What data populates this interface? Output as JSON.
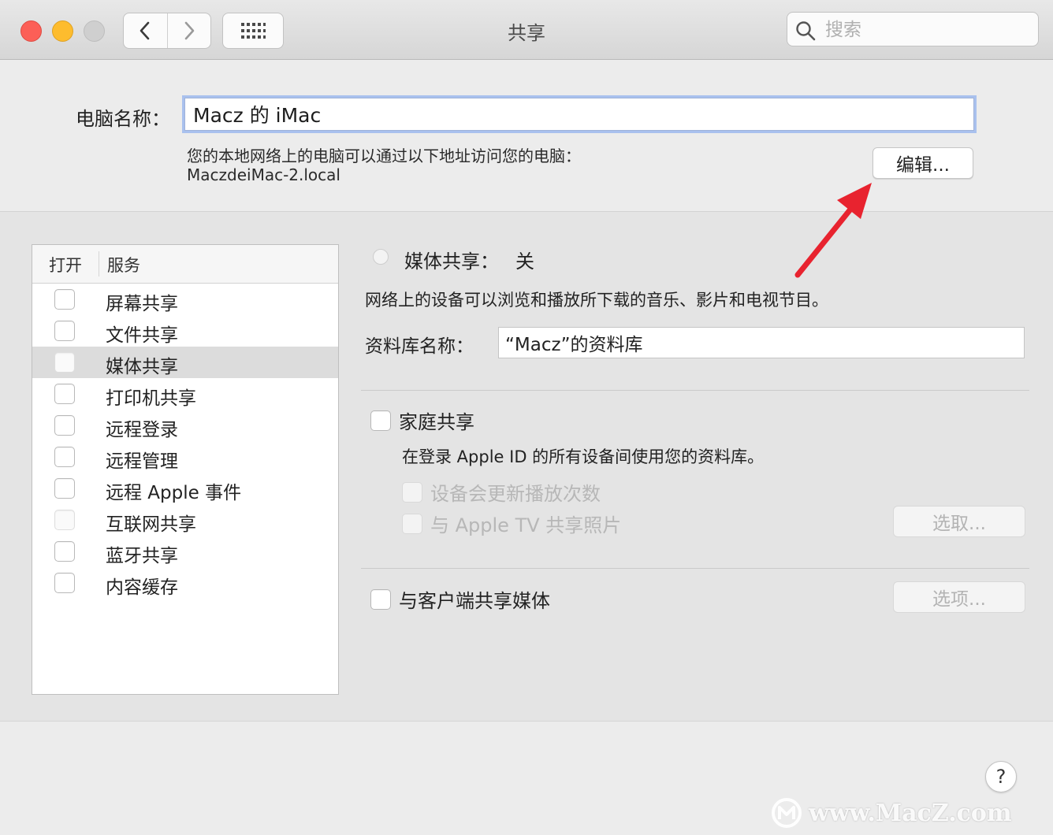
{
  "window": {
    "title": "共享",
    "search_placeholder": "搜索"
  },
  "computer_name": {
    "label": "电脑名称：",
    "value": "Macz 的 iMac",
    "address_desc": "您的本地网络上的电脑可以通过以下地址访问您的电脑：",
    "address": "MaczdeiMac-2.local",
    "edit_button": "编辑..."
  },
  "services": {
    "col_on": "打开",
    "col_service": "服务",
    "selected": "媒体共享",
    "items": [
      {
        "label": "屏幕共享",
        "checked": false
      },
      {
        "label": "文件共享",
        "checked": false
      },
      {
        "label": "媒体共享",
        "checked": false
      },
      {
        "label": "打印机共享",
        "checked": false
      },
      {
        "label": "远程登录",
        "checked": false
      },
      {
        "label": "远程管理",
        "checked": false
      },
      {
        "label": "远程 Apple 事件",
        "checked": false
      },
      {
        "label": "互联网共享",
        "checked": false
      },
      {
        "label": "蓝牙共享",
        "checked": false
      },
      {
        "label": "内容缓存",
        "checked": false
      }
    ]
  },
  "media_sharing": {
    "title": "媒体共享：",
    "state": "关",
    "description": "网络上的设备可以浏览和播放所下载的音乐、影片和电视节目。",
    "library_label": "资料库名称：",
    "library_value": "“Macz”的资料库",
    "home_sharing": {
      "label": "家庭共享",
      "checked": false,
      "description": "在登录 Apple ID 的所有设备间使用您的资料库。",
      "update_play_counts": "设备会更新播放次数",
      "share_photos": "与 Apple TV 共享照片",
      "choose_button": "选取..."
    },
    "share_with_clients": {
      "label": "与客户端共享媒体",
      "checked": false,
      "options_button": "选项..."
    }
  },
  "help_label": "?",
  "watermark": "www.MacZ.com",
  "colors": {
    "close": "#fc5f57",
    "minimize": "#fdbc2e",
    "focus_ring": "#a9c1ee",
    "annotation_arrow": "#e8232f"
  },
  "icons": [
    "back-chevron-icon",
    "forward-chevron-icon",
    "show-all-grid-icon",
    "magnifier-icon",
    "annotation-arrow",
    "macz-logo-icon"
  ]
}
